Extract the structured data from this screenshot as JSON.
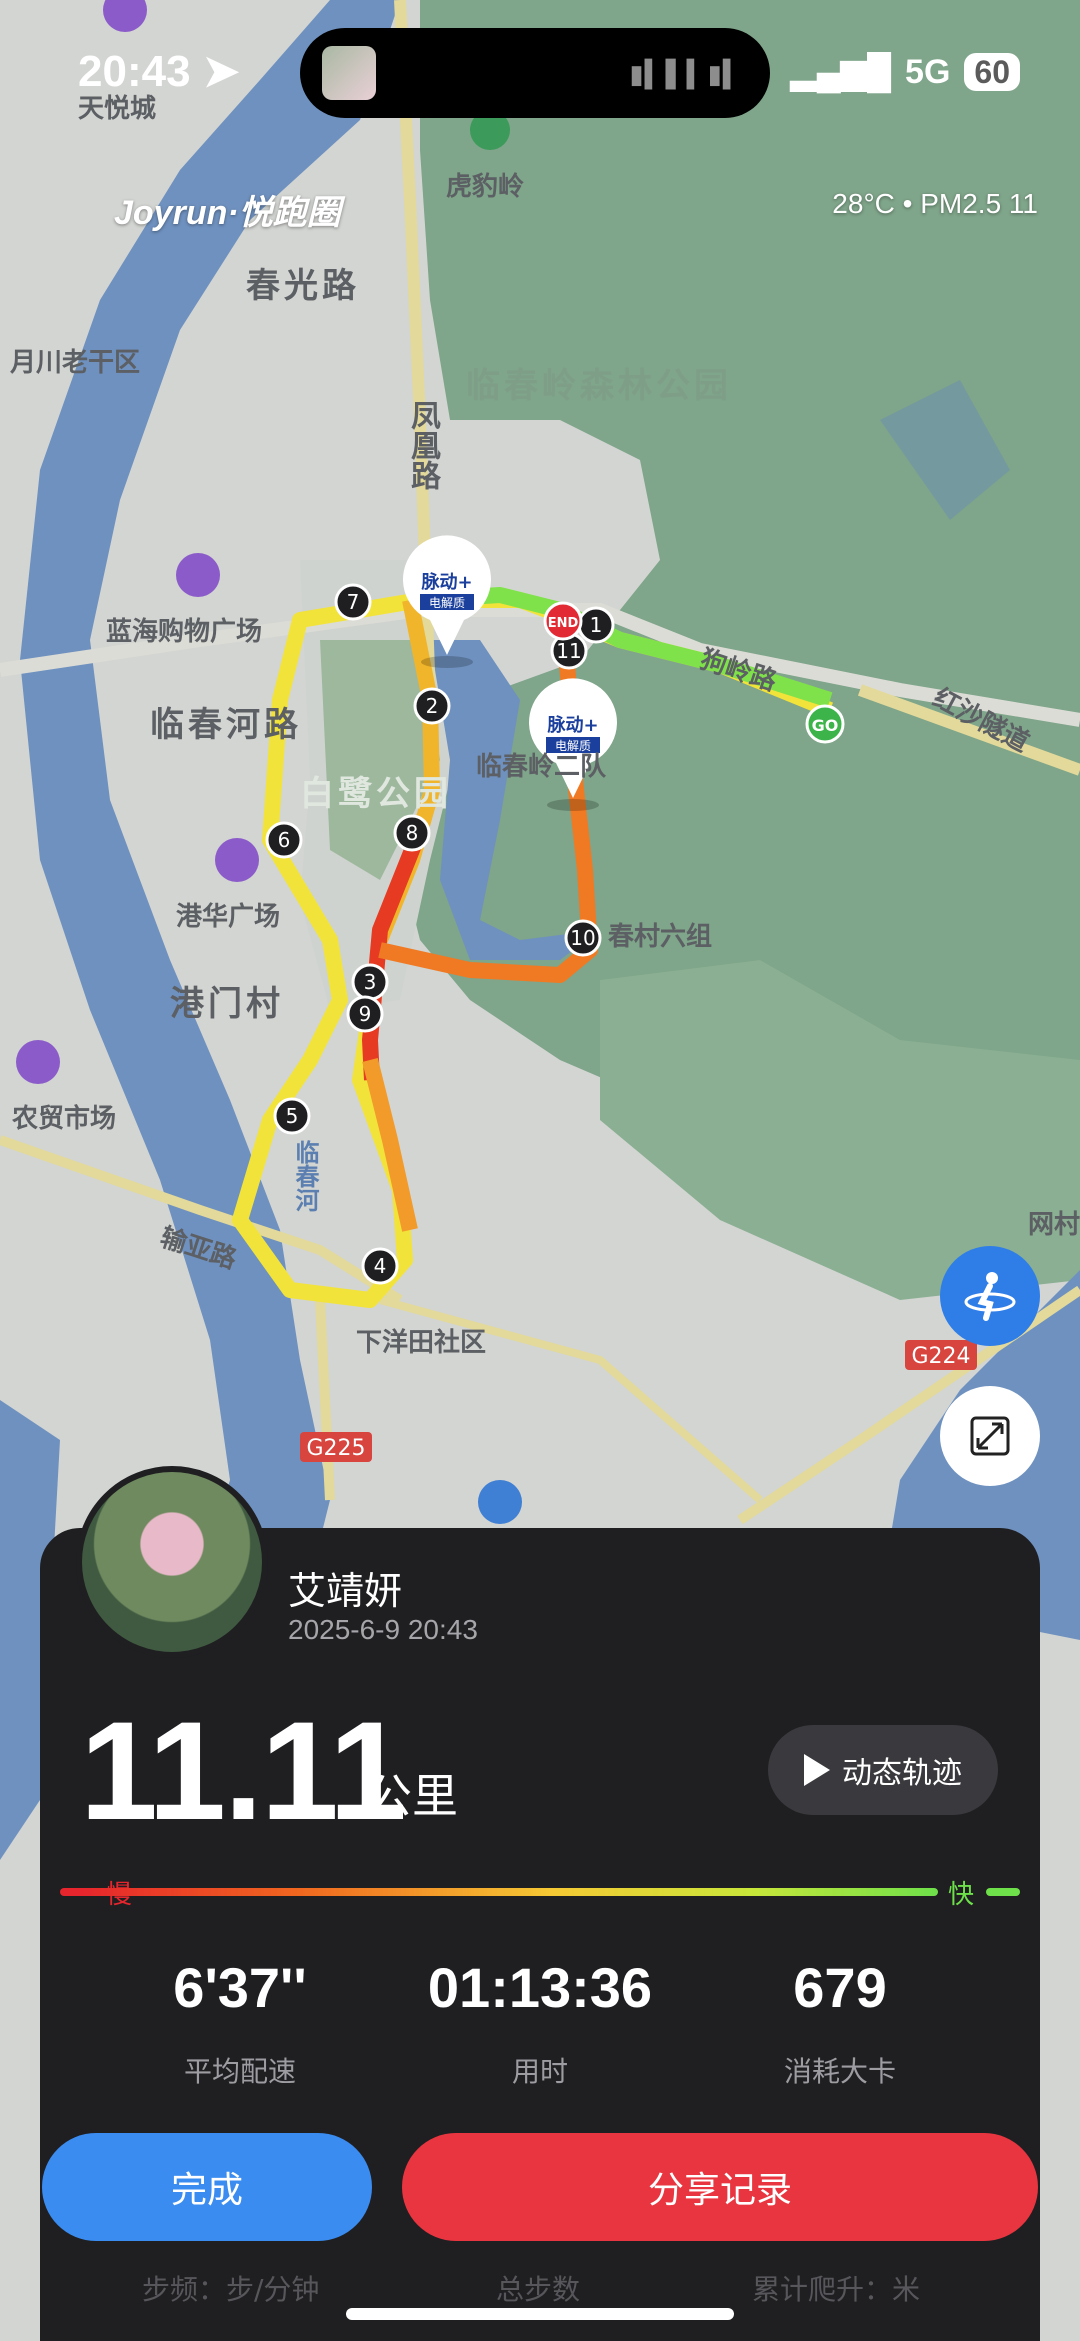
{
  "status_bar": {
    "time": "20:43",
    "network": "5G",
    "battery": "60"
  },
  "header": {
    "brand": "Joyrun·悦跑圈",
    "weather": "28°C • PM2.5 11"
  },
  "map": {
    "labels": [
      "春光路",
      "临春岭森林公园",
      "凤凰路",
      "蓝海购物广场",
      "临春河路",
      "白鹭公园",
      "临春岭二队",
      "港华广场",
      "港门村",
      "春村六组",
      "农贸市场",
      "输亚路",
      "下洋田社区",
      "临春河",
      "月川老干区",
      "虎豹岭",
      "天悦城",
      "红沙隧道",
      "狗岭路",
      "网村"
    ],
    "road_badges": [
      "G224",
      "G225"
    ],
    "markers": {
      "start": "GO",
      "end": "END",
      "sponsor_line1": "脉动+",
      "sponsor_line2": "电解质"
    },
    "km_markers": [
      "1",
      "2",
      "3",
      "4",
      "5",
      "6",
      "7",
      "8",
      "9",
      "10",
      "11"
    ]
  },
  "controls": {
    "mode_icon": "runner-icon",
    "expand_icon": "expand-icon"
  },
  "summary": {
    "user_name": "艾靖妍",
    "date": "2025-6-9 20:43",
    "distance": "11.11",
    "unit": "公里",
    "replay_label": "动态轨迹",
    "pace_slow": "慢",
    "pace_fast": "快",
    "stats": [
      {
        "value": "6'37''",
        "label": "平均配速"
      },
      {
        "value": "01:13:36",
        "label": "用时"
      },
      {
        "value": "679",
        "label": "消耗大卡"
      }
    ],
    "done_label": "完成",
    "share_label": "分享记录",
    "more_stats": [
      "步频：步/分钟",
      "总步数",
      "累计爬升：米"
    ]
  },
  "colors": {
    "done": "#3a8cf0",
    "share": "#e9353f",
    "card": "#1f1f22"
  }
}
